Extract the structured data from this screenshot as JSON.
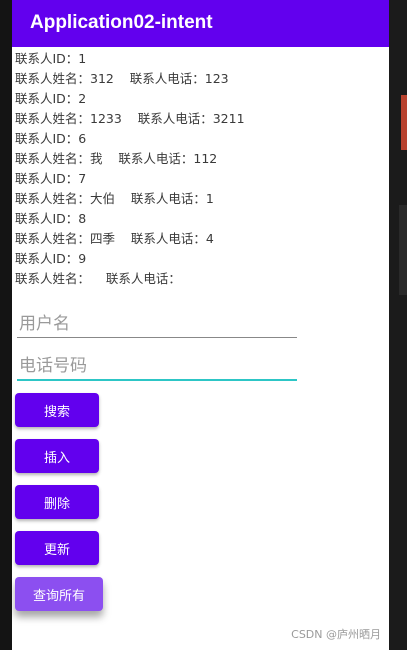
{
  "app_bar": {
    "title": "Application02-intent"
  },
  "contacts": [
    {
      "id_line": "联系人ID：1",
      "info_line": "联系人姓名：312    联系人电话：123"
    },
    {
      "id_line": "联系人ID：2",
      "info_line": "联系人姓名：1233    联系人电话：3211"
    },
    {
      "id_line": "联系人ID：6",
      "info_line": "联系人姓名：我    联系人电话：112"
    },
    {
      "id_line": "联系人ID：7",
      "info_line": "联系人姓名：大伯    联系人电话：1"
    },
    {
      "id_line": "联系人ID：8",
      "info_line": "联系人姓名：四季    联系人电话：4"
    },
    {
      "id_line": "联系人ID：9",
      "info_line": "联系人姓名：    联系人电话："
    }
  ],
  "form": {
    "username_placeholder": "用户名",
    "username_value": "",
    "phone_placeholder": "电话号码",
    "phone_value": ""
  },
  "buttons": {
    "search": "搜索",
    "insert": "插入",
    "delete": "删除",
    "update": "更新",
    "query_all": "查询所有"
  },
  "watermark": "CSDN @庐州晒月",
  "colors": {
    "primary": "#6200ee",
    "focus_underline": "#2dc6c6",
    "pressed_button": "#8c4ff0"
  }
}
